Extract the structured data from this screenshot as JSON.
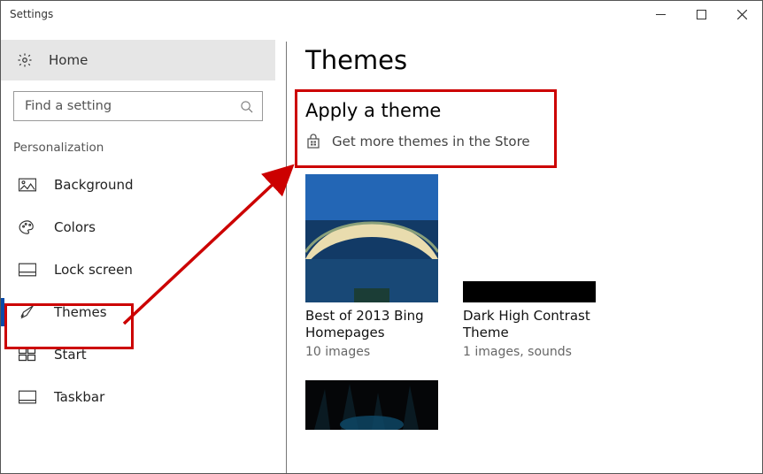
{
  "window": {
    "title": "Settings"
  },
  "sidebar": {
    "home_label": "Home",
    "search_placeholder": "Find a setting",
    "section_label": "Personalization",
    "items": [
      {
        "label": "Background"
      },
      {
        "label": "Colors"
      },
      {
        "label": "Lock screen"
      },
      {
        "label": "Themes"
      },
      {
        "label": "Start"
      },
      {
        "label": "Taskbar"
      }
    ]
  },
  "main": {
    "page_title": "Themes",
    "apply_header": "Apply a theme",
    "store_link": "Get more themes in the Store",
    "themes": [
      {
        "name": "Best of 2013 Bing Homepages",
        "sub": "10 images"
      },
      {
        "name": "Dark High Contrast Theme",
        "sub": "1 images, sounds"
      }
    ]
  }
}
